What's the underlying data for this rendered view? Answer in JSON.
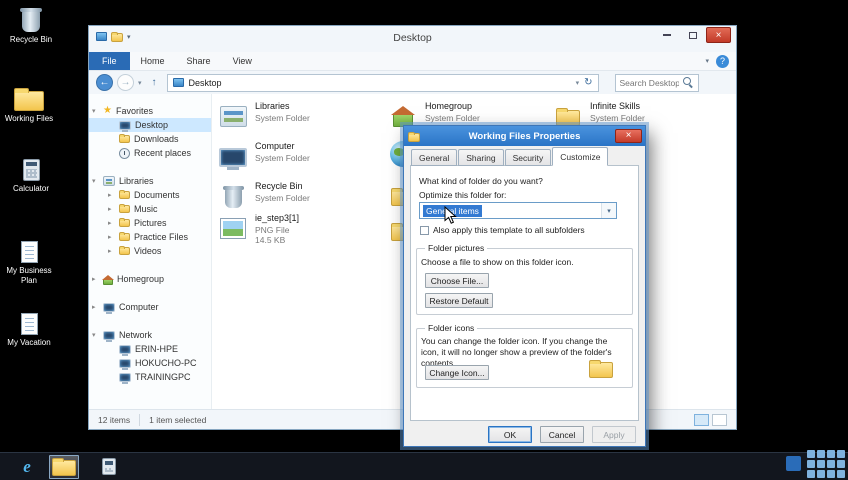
{
  "glyphs": {
    "close": "×",
    "back": "←",
    "forward": "→",
    "up": "↑",
    "refresh": "↻",
    "chevron_down": "▾",
    "chevron_right": "▸",
    "star": "★",
    "help": "?",
    "dropdown": "▾"
  },
  "desktop": {
    "icons": [
      {
        "label": "Recycle Bin"
      },
      {
        "label": "Working Files"
      },
      {
        "label": "Calculator"
      },
      {
        "label": "My Business Plan"
      },
      {
        "label": "My Vacation"
      }
    ]
  },
  "explorer": {
    "window_title": "Desktop",
    "ribbon": {
      "file": "File",
      "tabs": [
        "Home",
        "Share",
        "View"
      ]
    },
    "address": {
      "location": "Desktop"
    },
    "search": {
      "placeholder": "Search Desktop"
    },
    "nav": [
      {
        "label": "Favorites"
      },
      {
        "label": "Desktop"
      },
      {
        "label": "Downloads"
      },
      {
        "label": "Recent places"
      },
      {
        "label": "Libraries"
      },
      {
        "label": "Documents"
      },
      {
        "label": "Music"
      },
      {
        "label": "Pictures"
      },
      {
        "label": "Practice Files"
      },
      {
        "label": "Videos"
      },
      {
        "label": "Homegroup"
      },
      {
        "label": "Computer"
      },
      {
        "label": "Network"
      },
      {
        "label": "ERIN-HPE"
      },
      {
        "label": "HOKUCHO-PC"
      },
      {
        "label": "TRAININGPC"
      }
    ],
    "items": [
      {
        "name": "Libraries",
        "type": "System Folder"
      },
      {
        "name": "Computer",
        "type": "System Folder"
      },
      {
        "name": "Recycle Bin",
        "type": "System Folder"
      },
      {
        "name": "ie_step3[1]",
        "type": "PNG File",
        "size": "14.5 KB"
      },
      {
        "name": "Homegroup",
        "type": "System Folder"
      },
      {
        "name": "Infinite Skills",
        "type": "System Folder"
      }
    ],
    "status": {
      "items_count": "12 items",
      "selected": "1 item selected"
    }
  },
  "dialog": {
    "title": "Working Files Properties",
    "tabs": [
      "General",
      "Sharing",
      "Security",
      "Customize"
    ],
    "body": {
      "heading": "What kind of folder do you want?",
      "optimize_label": "Optimize this folder for:",
      "optimize_value": "General items",
      "checkbox_label": "Also apply this template to all subfolders",
      "pictures_group": "Folder pictures",
      "pictures_text": "Choose a file to show on this folder icon.",
      "choose_file": "Choose File...",
      "restore_default": "Restore Default",
      "icons_group": "Folder icons",
      "icons_text": "You can change the folder icon. If you change the icon, it will no longer show a preview of the folder's contents.",
      "change_icon": "Change Icon..."
    },
    "buttons": {
      "ok": "OK",
      "cancel": "Cancel",
      "apply": "Apply"
    }
  },
  "colors": {
    "accent": "#2a74c4",
    "dialog_titlebar": "#2e82d6",
    "close_red": "#cf4437",
    "selection": "#cde8ff"
  }
}
